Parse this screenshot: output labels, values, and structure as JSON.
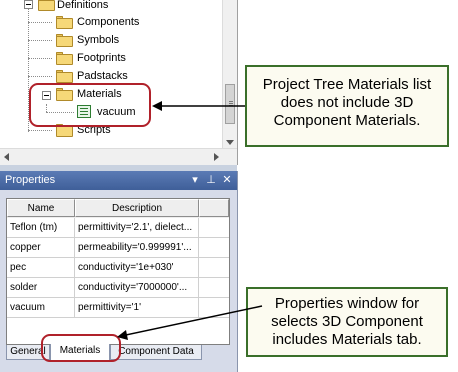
{
  "tree": {
    "items": [
      {
        "label": "Definitions",
        "expanded": true
      },
      {
        "label": "Components"
      },
      {
        "label": "Symbols"
      },
      {
        "label": "Footprints"
      },
      {
        "label": "Padstacks"
      },
      {
        "label": "Materials",
        "expanded": true
      },
      {
        "label": "vacuum"
      },
      {
        "label": "Scripts"
      }
    ]
  },
  "properties": {
    "title": "Properties",
    "controls": {
      "dropdown": "▾",
      "pin": "⊥",
      "close": "✕"
    },
    "columns": [
      "Name",
      "Description"
    ],
    "rows": [
      {
        "name": "Teflon (tm)",
        "description": "permittivity='2.1', dielect..."
      },
      {
        "name": "copper",
        "description": "permeability='0.999991'..."
      },
      {
        "name": "pec",
        "description": "conductivity='1e+030'"
      },
      {
        "name": "solder",
        "description": "conductivity='7000000'..."
      },
      {
        "name": "vacuum",
        "description": "permittivity='1'"
      }
    ],
    "tabs": [
      "General",
      "Materials",
      "Component Data"
    ],
    "active_tab": "Materials"
  },
  "callouts": {
    "top": [
      "Project Tree Materials list",
      "does not include 3D",
      "Component Materials."
    ],
    "bottom": [
      "Properties window for",
      "selects 3D Component",
      "includes Materials tab."
    ]
  },
  "colors": {
    "callout_border": "#3a6f2a",
    "highlight_oval": "#b0212a",
    "title_bar": "#4a6ba8"
  }
}
